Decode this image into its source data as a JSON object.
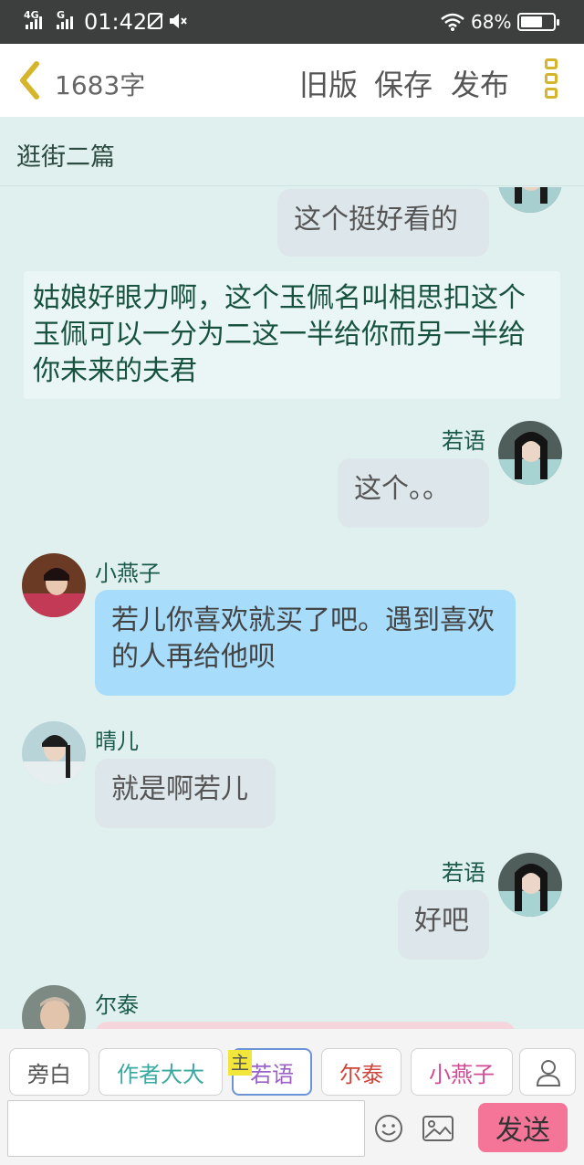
{
  "status_bar": {
    "network_1": "4G",
    "network_2": "G",
    "time": "01:42",
    "battery_percent": "68%",
    "battery_level": 0.68
  },
  "header": {
    "word_count": "1683字",
    "old_version_label": "旧版",
    "save_label": "保存",
    "publish_label": "发布"
  },
  "chapter_title": "逛街二篇",
  "messages": {
    "m1": {
      "text": "这个挺好看的"
    },
    "narration": {
      "text": "姑娘好眼力啊，这个玉佩名叫相思扣这个玉佩可以一分为二这一半给你而另一半给你未来的夫君"
    },
    "m2": {
      "name": "若语",
      "text": "这个。。"
    },
    "m3": {
      "name": "小燕子",
      "text": "若儿你喜欢就买了吧。遇到喜欢的人再给他呗"
    },
    "m4": {
      "name": "晴儿",
      "text": "就是啊若儿"
    },
    "m5": {
      "name": "若语",
      "text": "好吧"
    },
    "m6": {
      "name": "尔泰"
    }
  },
  "characters": {
    "narrator": {
      "label": "旁白",
      "color": "#555555"
    },
    "author": {
      "label": "作者大大",
      "color": "#3aa9a0"
    },
    "ruoyu": {
      "label": "若语",
      "color": "#9a62c8",
      "main_badge": "主"
    },
    "ertai": {
      "label": "尔泰",
      "color": "#d0463c"
    },
    "xiaoyanzi": {
      "label": "小燕子",
      "color": "#d24a94"
    }
  },
  "composer": {
    "input_value": "",
    "send_label": "发送"
  }
}
